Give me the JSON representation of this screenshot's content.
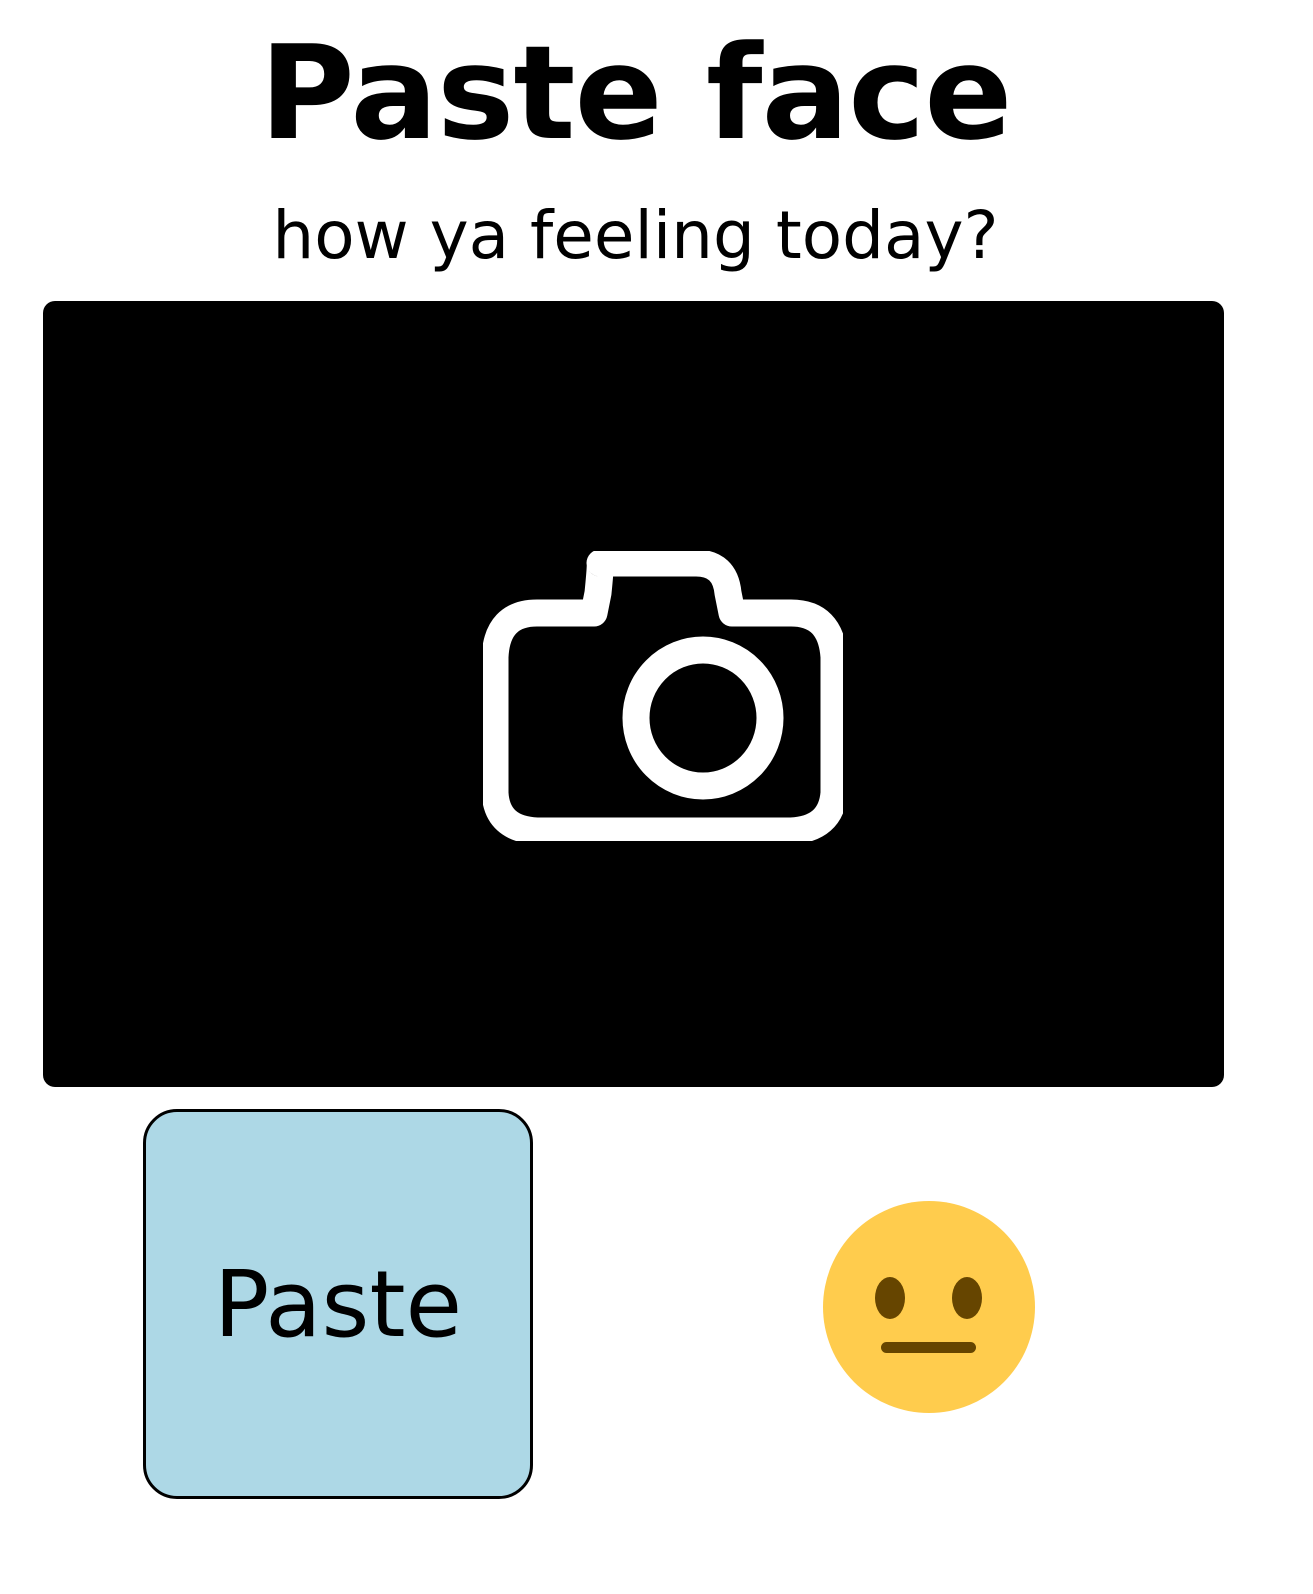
{
  "header": {
    "title": "Paste face",
    "subtitle": "how ya feeling today?"
  },
  "preview": {
    "icon": "camera-icon",
    "background_color": "#000000"
  },
  "controls": {
    "paste_label": "Paste",
    "paste_button_color": "#add8e6"
  },
  "mood": {
    "icon": "neutral-face-emoji",
    "color": "#ffcc4d"
  }
}
